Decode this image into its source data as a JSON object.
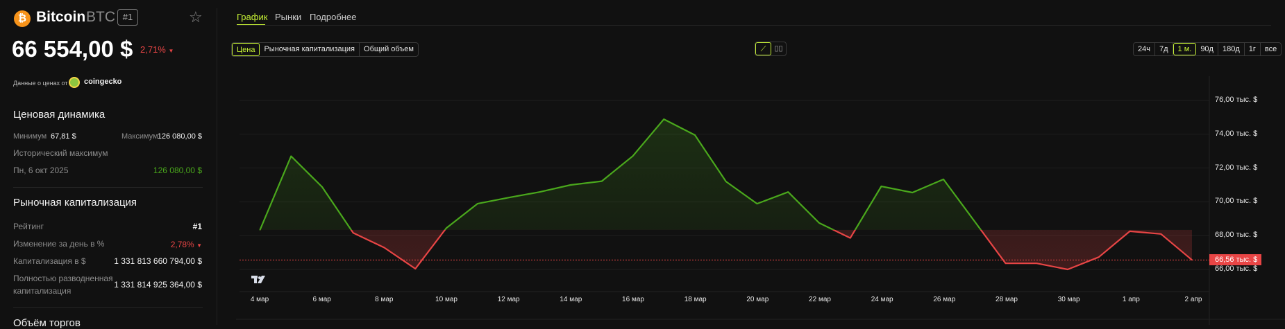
{
  "coin": {
    "name": "Bitcoin",
    "symbol": "BTC",
    "rank_badge": "#1",
    "price": "66 554,00 $",
    "change": "2,71%",
    "source_label": "Данные о ценах от",
    "source_name": "coingecko"
  },
  "price_dynamics": {
    "title": "Ценовая динамика",
    "min_label": "Минимум",
    "min_value": "67,81 $",
    "max_label": "Максимум",
    "max_value": "126 080,00 $",
    "ath_label": "Исторический максимум",
    "ath_date": "Пн, 6 окт 2025",
    "ath_value": "126 080,00 $"
  },
  "market_cap": {
    "title": "Рыночная капитализация",
    "rows": [
      {
        "label": "Рейтинг",
        "value": "#1"
      },
      {
        "label": "Изменение за день в %",
        "value": "2,78%"
      },
      {
        "label": "Капитализация в $",
        "value": "1 331 813 660 794,00 $"
      },
      {
        "label": "Полностью разводненная капитализация",
        "label_1": "Полностью разводненная",
        "label_2": "капитализация",
        "value": "1 331 814 925 364,00 $"
      }
    ]
  },
  "volume": {
    "title": "Объём торгов"
  },
  "tabs": [
    "График",
    "Рынки",
    "Подробнее"
  ],
  "metric_buttons": [
    "Цена",
    "Рыночная капитализация",
    "Общий объем"
  ],
  "range_buttons": [
    "24ч",
    "7д",
    "1 м.",
    "90д",
    "180д",
    "1г",
    "все"
  ],
  "colors": {
    "up": "#4aa81c",
    "down": "#e84545",
    "accent": "#c6f135",
    "bg": "#111111"
  },
  "chart_data": {
    "type": "area",
    "title": "",
    "xlabel": "",
    "ylabel": "",
    "x_tick_labels": [
      "4 мар",
      "6 мар",
      "8 мар",
      "10 мар",
      "12 мар",
      "14 мар",
      "16 мар",
      "18 мар",
      "20 мар",
      "22 мар",
      "24 мар",
      "26 мар",
      "28 мар",
      "30 мар",
      "1 апр",
      "2 апр"
    ],
    "y_tick_labels": [
      "76,00 тыс. $",
      "74,00 тыс. $",
      "72,00 тыс. $",
      "70,00 тыс. $",
      "68,00 тыс. $",
      "66,00 тыс. $"
    ],
    "y_ticks": [
      76,
      74,
      72,
      70,
      68,
      66
    ],
    "ylim": [
      65.8,
      77.2
    ],
    "unit": "тыс. $",
    "baseline": 68.34,
    "values": [
      68.34,
      72.7,
      70.88,
      68.16,
      67.29,
      66.04,
      68.45,
      69.89,
      70.25,
      70.58,
      71.0,
      71.22,
      72.71,
      74.89,
      73.95,
      71.2,
      69.89,
      70.58,
      68.75,
      67.86,
      70.92,
      70.55,
      71.33,
      68.85,
      66.36,
      66.36,
      66.0,
      66.73,
      68.26,
      68.1,
      66.56
    ],
    "current_value": 66.56,
    "current_label": "66,56 тыс. $",
    "grid": true
  }
}
